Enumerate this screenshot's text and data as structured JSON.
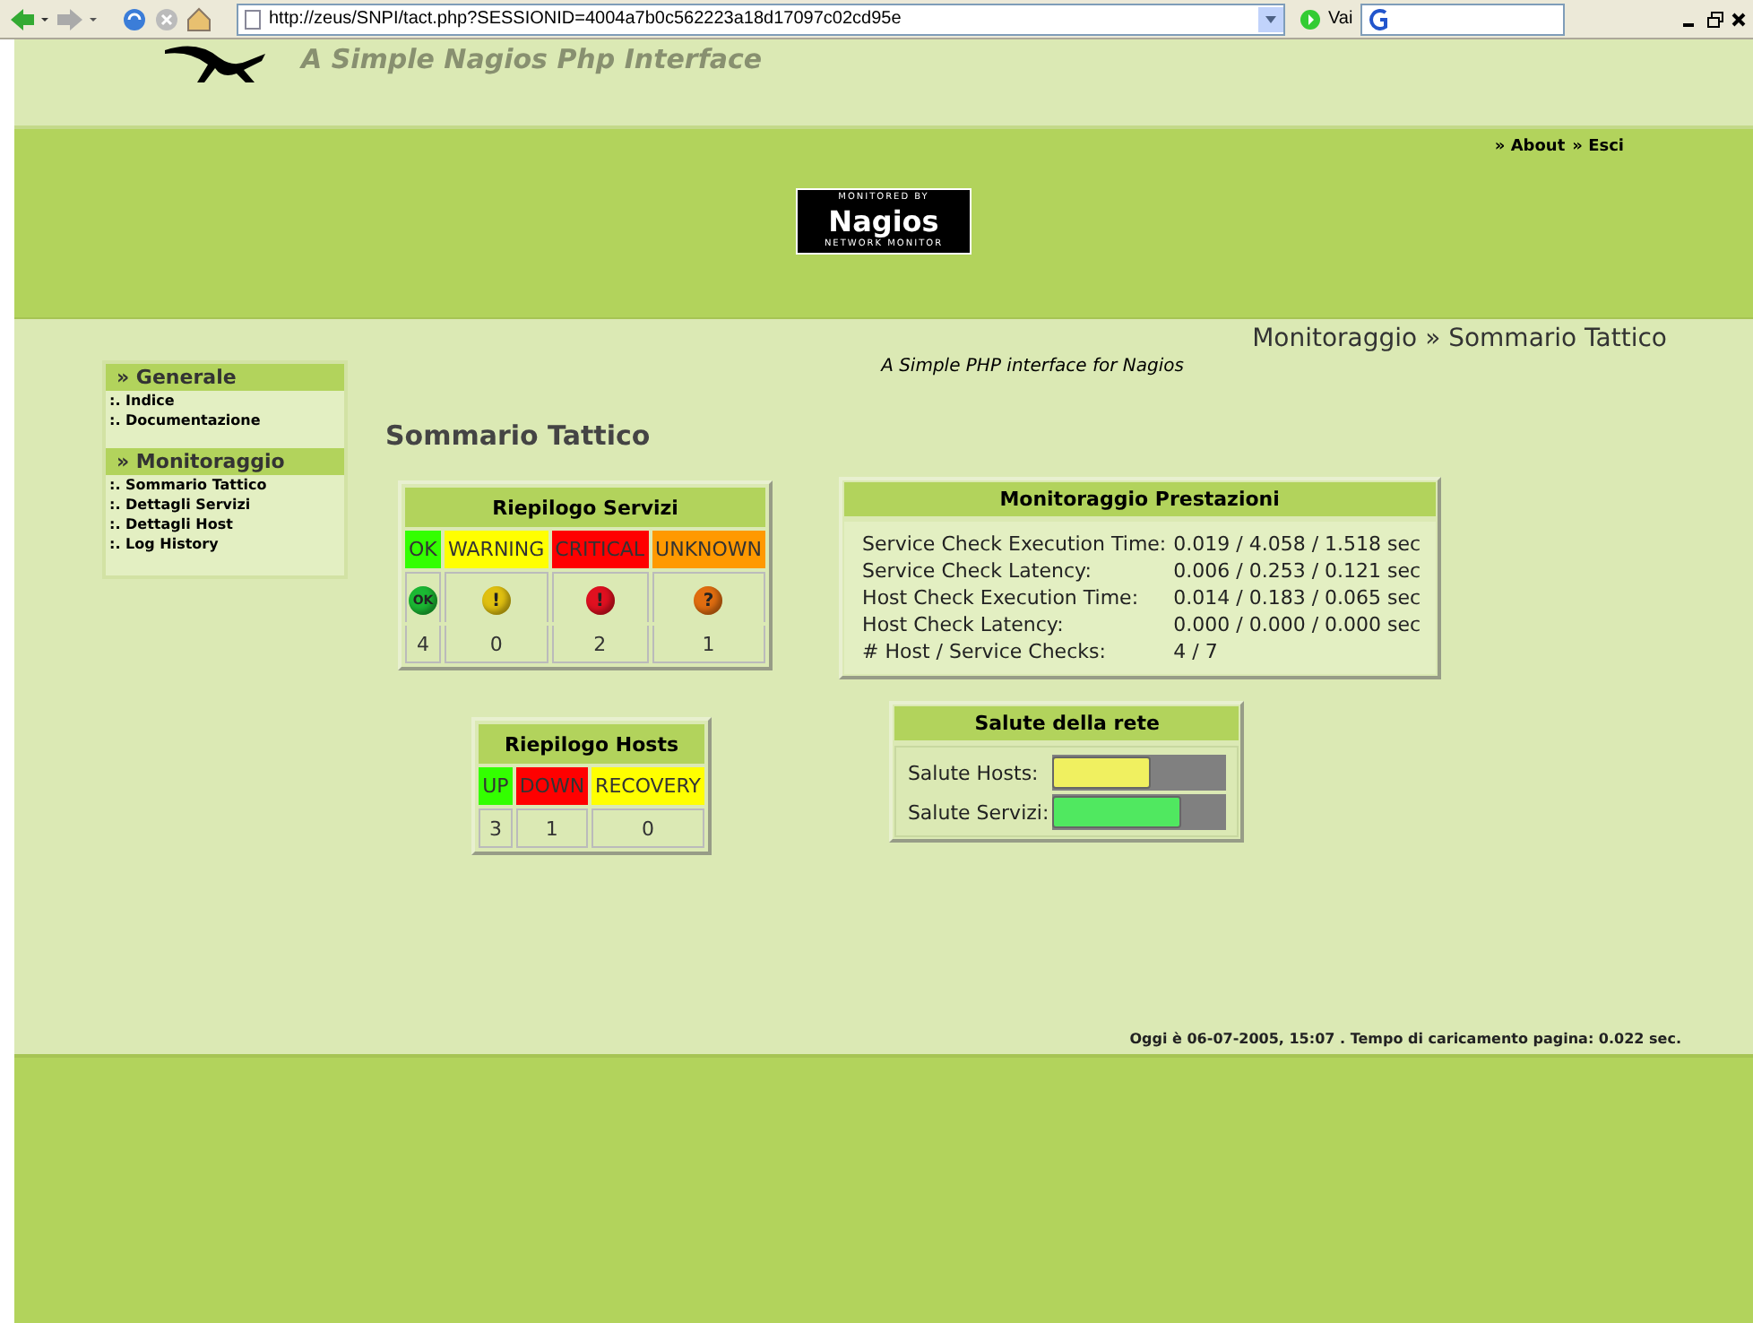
{
  "browser": {
    "url": "http://zeus/SNPI/tact.php?SESSIONID=4004a7b0c562223a18d17097c02cd95e",
    "go_label": "Vai"
  },
  "banner": {
    "title": "A Simple Nagios Php Interface"
  },
  "header": {
    "links": [
      "» About",
      "» Esci"
    ],
    "logo": {
      "top": "MONITORED BY",
      "name": "Nagios",
      "bottom": "NETWORK MONITOR"
    }
  },
  "breadcrumb": "Monitoraggio » Sommario Tattico",
  "subtitle": "A Simple PHP interface for Nagios",
  "sidebar": [
    {
      "title": "» Generale",
      "items": [
        ":. Indice",
        ":. Documentazione"
      ]
    },
    {
      "title": "» Monitoraggio",
      "items": [
        ":. Sommario Tattico",
        ":. Dettagli Servizi",
        ":. Dettagli Host",
        ":. Log History"
      ]
    }
  ],
  "heading": "Sommario Tattico",
  "services": {
    "title": "Riepilogo Servizi",
    "columns": [
      {
        "label": "OK",
        "color": "#33ff00",
        "symbol": "OK",
        "kind": "ok",
        "count": "4"
      },
      {
        "label": "WARNING",
        "color": "#ffff00",
        "symbol": "!",
        "kind": "warning",
        "count": "0"
      },
      {
        "label": "CRITICAL",
        "color": "#ff0000",
        "symbol": "!",
        "kind": "critical",
        "count": "2"
      },
      {
        "label": "UNKNOWN",
        "color": "#ff9900",
        "symbol": "?",
        "kind": "unknown",
        "count": "1"
      }
    ]
  },
  "hosts": {
    "title": "Riepilogo Hosts",
    "columns": [
      {
        "label": "UP",
        "color": "#33ff00",
        "count": "3"
      },
      {
        "label": "DOWN",
        "color": "#ff0000",
        "count": "1"
      },
      {
        "label": "RECOVERY",
        "color": "#ffff00",
        "count": "0"
      }
    ]
  },
  "performance": {
    "title": "Monitoraggio Prestazioni",
    "rows": [
      {
        "label": "Service Check Execution Time:",
        "value": "0.019 / 4.058 / 1.518 sec"
      },
      {
        "label": "Service Check Latency:",
        "value": "0.006 / 0.253 / 0.121 sec"
      },
      {
        "label": "Host Check Execution Time:",
        "value": "0.014 / 0.183 / 0.065 sec"
      },
      {
        "label": "Host Check Latency:",
        "value": "0.000 / 0.000 / 0.000 sec"
      },
      {
        "label": "# Host / Service Checks:",
        "value": "4 / 7"
      }
    ]
  },
  "health": {
    "title": "Salute della rete",
    "rows": [
      {
        "label": "Salute Hosts:",
        "level": 0.57,
        "color": "#f0f060"
      },
      {
        "label": "Salute Servizi:",
        "level": 0.74,
        "color": "#50e860"
      }
    ]
  },
  "footer": "Oggi è 06-07-2005, 15:07 . Tempo di caricamento pagina: 0.022 sec."
}
